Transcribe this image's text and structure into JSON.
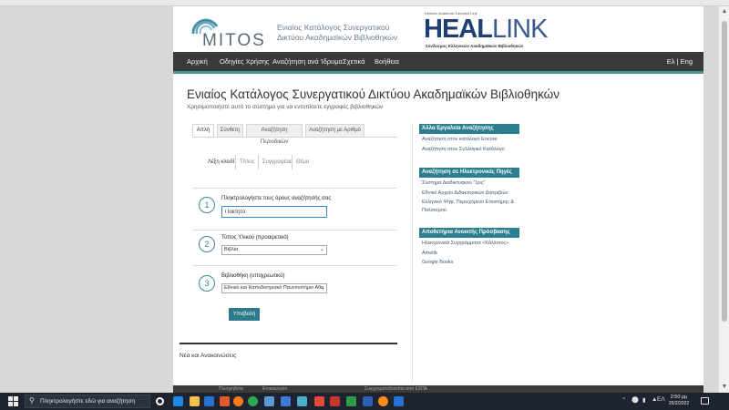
{
  "header": {
    "mitos_logo_text": "MITOS",
    "mitos_subtitle_line1": "Ενιαίος Κατάλογος Συνεργατικού",
    "mitos_subtitle_line2": "Δικτύου Ακαδημαϊκών Βιβλιοθηκών",
    "heal_top": "Hellenic Academic Libraries Link",
    "heal_word_bold": "HEAL",
    "heal_word_light": "LINK",
    "heal_subtitle": "Σύνδεσμος Ελληνικών Ακαδημαϊκών Βιβλιοθηκών"
  },
  "nav": {
    "items": [
      "Αρχική",
      "Οδηγίες Χρήσης",
      "Αναζήτηση ανά Ίδρυμα",
      "Σχετικά",
      "Βοήθεια"
    ],
    "language": "Ελ | Eng"
  },
  "main": {
    "title": "Ενιαίος Κατάλογος Συνεργατικού Δικτύου Ακαδημαϊκών Βιβλιοθηκών",
    "subtitle": "Χρησιμοποιήστε αυτό το σύστημα για να εντοπίσετε εγγραφές βιβλιοθηκών"
  },
  "tabs": [
    "Απλή",
    "Σύνθετη",
    "Αναζήτηση Περιοδικών",
    "Αναζήτηση με Αριθμό"
  ],
  "subtabs": [
    "Λέξη κλειδί",
    "Τίτλος",
    "Συγγραφέας",
    "Θέμα"
  ],
  "steps": [
    {
      "number": "1",
      "label": "Πληκτρολογήστε τους όρους αναζήτησής σας"
    },
    {
      "number": "2",
      "label": "Τύπος Υλικού (προαιρετικό)"
    },
    {
      "number": "3",
      "label": "Βιβλιοθήκη (υποχρεωτικό)"
    }
  ],
  "search": {
    "value": "Πακτητό"
  },
  "material_select": {
    "value": "Βιβλία"
  },
  "library_select": {
    "value": "Εθνικό και Καποδιστριακό Πανεπιστήμιο Αθη"
  },
  "submit_label": "Υποβολή",
  "news_title": "Νέα και Ανακοινώσεις",
  "sidebar": {
    "sections": [
      {
        "title": "Άλλα Εργαλεία Αναζήτησης",
        "links": [
          "Αναζήτηση στον κατάλογο Encore",
          "Αναζήτηση στον Συλλογικό Κατάλογο"
        ]
      },
      {
        "title": "Αναζήτηση σε Ηλεκτρονικές Πηγές",
        "links": [
          "Σύστημα Διαδικτυακού \"Ίρις\"",
          "Εθνικό Αρχείο Διδακτορικών Διατριβών",
          "Ελληνικό Ψηφ. Περιεχόμενο Επιστήμης & Πολιτισμού"
        ]
      },
      {
        "title": "Αποθετήρια Ανοικτής Πρόσβασης",
        "links": [
          "Ηλεκτρονικά Συγγράμματα «Κάλλιπος»",
          "Amelib",
          "Google Books"
        ]
      }
    ]
  },
  "footer": {
    "left": "Πλοηγηθείτε",
    "middle": "Επικοινωνία",
    "right": "Συγχρηματοδοτείται από ΕΣΠΑ"
  },
  "taskbar": {
    "search_placeholder": "Πληκτρολογήστε εδώ για αναζήτηση",
    "tray_lang": "ΕΛ",
    "time": "2:50 μμ",
    "date": "25/2/2022"
  },
  "colors": {
    "accent": "#2c7f8e",
    "navbar": "#3a3a3a",
    "heal_blue": "#1e3f74"
  }
}
